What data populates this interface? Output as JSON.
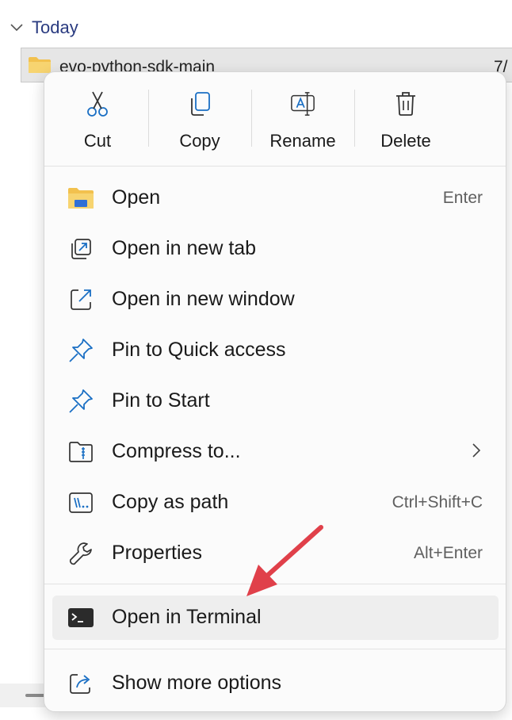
{
  "explorer": {
    "group_label": "Today",
    "file_name": "evo-python-sdk-main",
    "file_date": "7/"
  },
  "quick_actions": [
    {
      "label": "Cut",
      "icon": "scissors-icon"
    },
    {
      "label": "Copy",
      "icon": "copy-icon"
    },
    {
      "label": "Rename",
      "icon": "rename-icon"
    },
    {
      "label": "Delete",
      "icon": "trash-icon"
    }
  ],
  "menu_items": [
    {
      "label": "Open",
      "shortcut": "Enter",
      "icon": "folder-icon"
    },
    {
      "label": "Open in new tab",
      "shortcut": "",
      "icon": "new-tab-icon"
    },
    {
      "label": "Open in new window",
      "shortcut": "",
      "icon": "new-window-icon"
    },
    {
      "label": "Pin to Quick access",
      "shortcut": "",
      "icon": "pin-icon"
    },
    {
      "label": "Pin to Start",
      "shortcut": "",
      "icon": "pin-icon"
    },
    {
      "label": "Compress to...",
      "shortcut": "",
      "icon": "zip-folder-icon",
      "submenu": true
    },
    {
      "label": "Copy as path",
      "shortcut": "Ctrl+Shift+C",
      "icon": "copy-path-icon"
    },
    {
      "label": "Properties",
      "shortcut": "Alt+Enter",
      "icon": "wrench-icon"
    },
    {
      "label": "Open in Terminal",
      "shortcut": "",
      "icon": "terminal-icon",
      "highlighted": true
    },
    {
      "label": "Show more options",
      "shortcut": "",
      "icon": "share-icon"
    }
  ],
  "colors": {
    "accent_blue": "#1a6fc4",
    "annotation_arrow": "#e0404a",
    "folder_yellow": "#f5c542"
  }
}
